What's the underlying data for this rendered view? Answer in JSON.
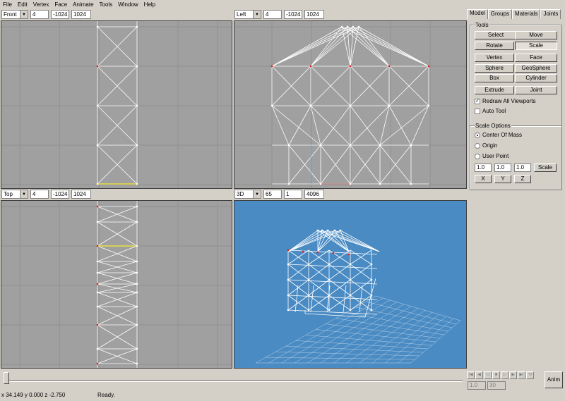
{
  "menu": [
    "File",
    "Edit",
    "Vertex",
    "Face",
    "Animate",
    "Tools",
    "Window",
    "Help"
  ],
  "viewports": [
    {
      "view": "Front",
      "a": "4",
      "b": "-1024",
      "c": "1024"
    },
    {
      "view": "Left",
      "a": "4",
      "b": "-1024",
      "c": "1024"
    },
    {
      "view": "Top",
      "a": "4",
      "b": "-1024",
      "c": "1024"
    },
    {
      "view": "3D",
      "a": "65",
      "b": "1",
      "c": "4096"
    }
  ],
  "tabs": [
    "Model",
    "Groups",
    "Materials",
    "Joints"
  ],
  "tools": {
    "title": "Tools",
    "select": "Select",
    "move": "Move",
    "rotate": "Rotate",
    "scale": "Scale",
    "vertex": "Vertex",
    "face": "Face",
    "sphere": "Sphere",
    "geosphere": "GeoSphere",
    "box": "Box",
    "cylinder": "Cylinder",
    "extrude": "Extrude",
    "joint": "Joint",
    "redraw": "Redraw All Viewports",
    "auto_tool": "Auto Tool"
  },
  "scale_options": {
    "title": "Scale Options",
    "center_of_mass": "Center Of Mass",
    "origin": "Origin",
    "user_point": "User Point",
    "x_val": "1.0",
    "y_val": "1.0",
    "z_val": "1.0",
    "scale_btn": "Scale",
    "x": "X",
    "y": "Y",
    "z": "Z"
  },
  "anim": {
    "button": "Anim",
    "val1": "1.0",
    "val2": "30"
  },
  "status": {
    "coords": "x 34.149 y 0.000 z -2.750",
    "message": "Ready."
  },
  "colors": {
    "viewport_bg": "#a0a0a0",
    "viewport_3d_bg": "#4a8bc3",
    "selected_vertex": "#e02020",
    "selected_edge": "#e8e040"
  }
}
